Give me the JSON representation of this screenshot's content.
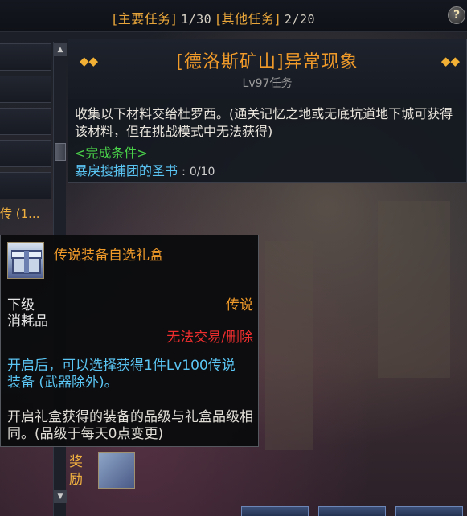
{
  "header": {
    "main_quest_label": "[主要任务]",
    "main_quest_count": "1/30",
    "other_quest_label": "[其他任务]",
    "other_quest_count": "2/20",
    "help_label": "?"
  },
  "quest": {
    "title": "[德洛斯矿山]异常现象",
    "level": "Lv97任务",
    "description": "收集以下材料交给杜罗西。(通关记忆之地或无底坑道地下城可获得该材料，但在挑战模式中无法获得)",
    "condition_header": "<完成条件>",
    "requirement_item": "暴戾搜捕团的圣书",
    "requirement_progress": "0/10"
  },
  "left_list": {
    "fragment_text": "传 (1..."
  },
  "reward": {
    "label": "奖励"
  },
  "tooltip": {
    "item_name": "传说装备自选礼盒",
    "grade": "下级",
    "item_type": "消耗品",
    "rarity": "传说",
    "trade_status": "无法交易/删除",
    "description": "开启后，可以选择获得1件Lv100传说装备 (武器除外)。",
    "note": "开启礼盒获得的装备的品级与礼盒品级相同。(品级于每天0点变更)"
  },
  "colors": {
    "accent_orange": "#f09a2a",
    "trade_red": "#ee2e2e",
    "desc_blue": "#5ac4f2",
    "condition_green": "#4ad24a"
  },
  "icons": [
    "help-icon",
    "diamond-marker-icon",
    "gift-box-icon",
    "scroll-up-icon",
    "scroll-down-icon"
  ]
}
